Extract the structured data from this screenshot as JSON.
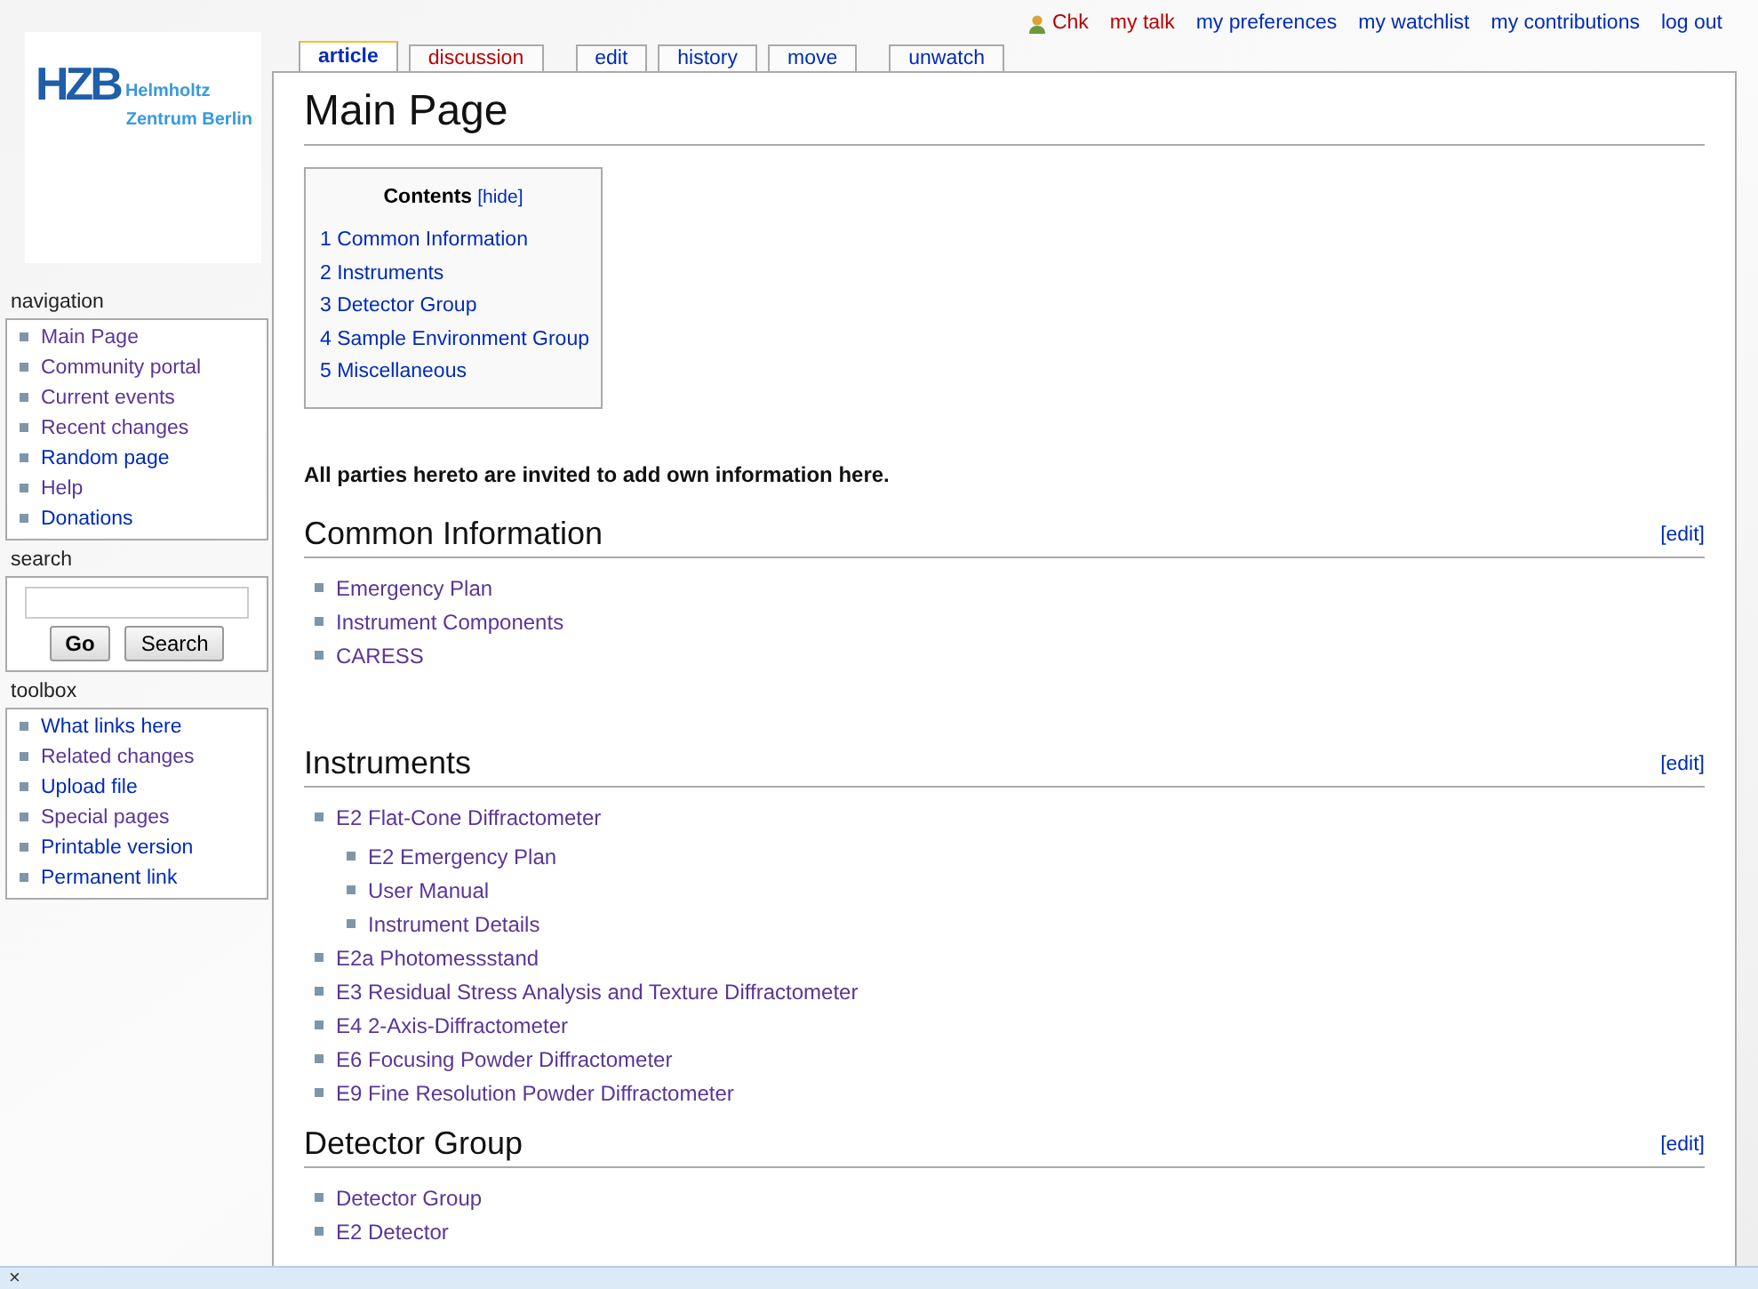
{
  "logo": {
    "mark": "HZB",
    "line1": "Helmholtz",
    "line2": "Zentrum Berlin"
  },
  "personal": [
    {
      "label": "Chk",
      "missing": true,
      "kind": "user"
    },
    {
      "label": "my talk",
      "missing": true,
      "kind": "link"
    },
    {
      "label": "my preferences",
      "missing": false,
      "kind": "link"
    },
    {
      "label": "my watchlist",
      "missing": false,
      "kind": "link"
    },
    {
      "label": "my contributions",
      "missing": false,
      "kind": "link"
    },
    {
      "label": "log out",
      "missing": false,
      "kind": "link"
    }
  ],
  "tabs": [
    {
      "label": "article",
      "selected": true,
      "missing": false
    },
    {
      "label": "discussion",
      "selected": false,
      "missing": true
    },
    {
      "label": "edit",
      "selected": false,
      "missing": false
    },
    {
      "label": "history",
      "selected": false,
      "missing": false
    },
    {
      "label": "move",
      "selected": false,
      "missing": false
    },
    {
      "label": "unwatch",
      "selected": false,
      "missing": false
    }
  ],
  "portlets": [
    {
      "title": "navigation",
      "kind": "links",
      "items": [
        {
          "label": "Main Page",
          "visited": true
        },
        {
          "label": "Community portal",
          "visited": true
        },
        {
          "label": "Current events",
          "visited": true
        },
        {
          "label": "Recent changes",
          "visited": true
        },
        {
          "label": "Random page",
          "visited": false
        },
        {
          "label": "Help",
          "visited": true
        },
        {
          "label": "Donations",
          "visited": false
        }
      ]
    },
    {
      "title": "search",
      "kind": "search",
      "buttons": [
        "Go",
        "Search"
      ]
    },
    {
      "title": "toolbox",
      "kind": "links",
      "items": [
        {
          "label": "What links here",
          "visited": false
        },
        {
          "label": "Related changes",
          "visited": true
        },
        {
          "label": "Upload file",
          "visited": false
        },
        {
          "label": "Special pages",
          "visited": true
        },
        {
          "label": "Printable version",
          "visited": false
        },
        {
          "label": "Permanent link",
          "visited": false
        }
      ]
    }
  ],
  "page_title": "Main Page",
  "toc": {
    "title": "Contents",
    "toggle": "[hide]",
    "items": [
      "1 Common Information",
      "2 Instruments",
      "3 Detector Group",
      "4 Sample Environment Group",
      "5 Miscellaneous"
    ]
  },
  "intro": "All parties hereto are invited to add own information here.",
  "sections": [
    {
      "title": "Common Information",
      "edit": "[edit]",
      "items": [
        {
          "label": "Emergency Plan"
        },
        {
          "label": "Instrument Components"
        },
        {
          "label": "CARESS"
        }
      ]
    },
    {
      "title": "Instruments",
      "edit": "[edit]",
      "items": [
        {
          "label": "E2 Flat-Cone Diffractometer",
          "children": [
            {
              "label": "E2 Emergency Plan"
            },
            {
              "label": "User Manual"
            },
            {
              "label": "Instrument Details"
            }
          ]
        },
        {
          "label": "E2a Photomessstand"
        },
        {
          "label": "E3 Residual Stress Analysis and Texture Diffractometer"
        },
        {
          "label": "E4 2-Axis-Diffractometer"
        },
        {
          "label": "E6 Focusing Powder Diffractometer"
        },
        {
          "label": "E9 Fine Resolution Powder Diffractometer"
        }
      ]
    },
    {
      "title": "Detector Group",
      "edit": "[edit]",
      "items": [
        {
          "label": "Detector Group"
        },
        {
          "label": "E2 Detector"
        }
      ]
    }
  ],
  "bottom_bar": {
    "close": "×"
  }
}
